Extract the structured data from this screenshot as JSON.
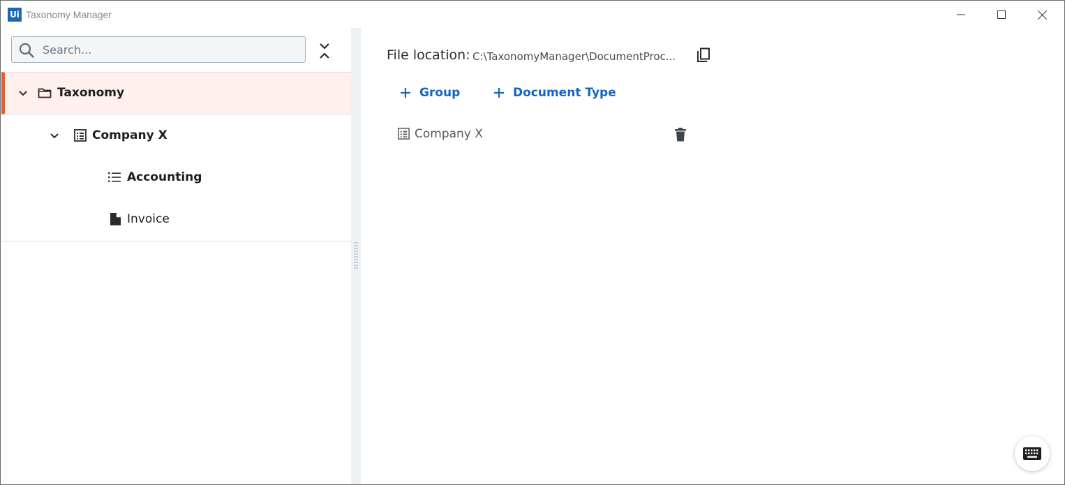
{
  "window": {
    "logo_text": "Ui",
    "title": "Taxonomy Manager"
  },
  "search": {
    "placeholder": "Search...",
    "value": ""
  },
  "tree": {
    "root": {
      "label": "Taxonomy",
      "icon": "folder-icon",
      "expanded": true,
      "selected": true
    },
    "group": {
      "label": "Company X",
      "icon": "group-icon",
      "expanded": true
    },
    "category": {
      "label": "Accounting",
      "icon": "list-icon"
    },
    "document_type": {
      "label": "Invoice",
      "icon": "document-icon"
    }
  },
  "details": {
    "file_location_label": "File location:",
    "file_location_value": "C:\\TaxonomyManager\\DocumentProc...",
    "add_group_label": "Group",
    "add_document_type_label": "Document Type",
    "children": [
      {
        "label": "Company X",
        "icon": "group-icon"
      }
    ]
  },
  "colors": {
    "accent": "#1565c0",
    "selection_bar": "#e0603a",
    "selection_bg": "#fdf0ed",
    "logo_bg": "#1a67b4"
  }
}
